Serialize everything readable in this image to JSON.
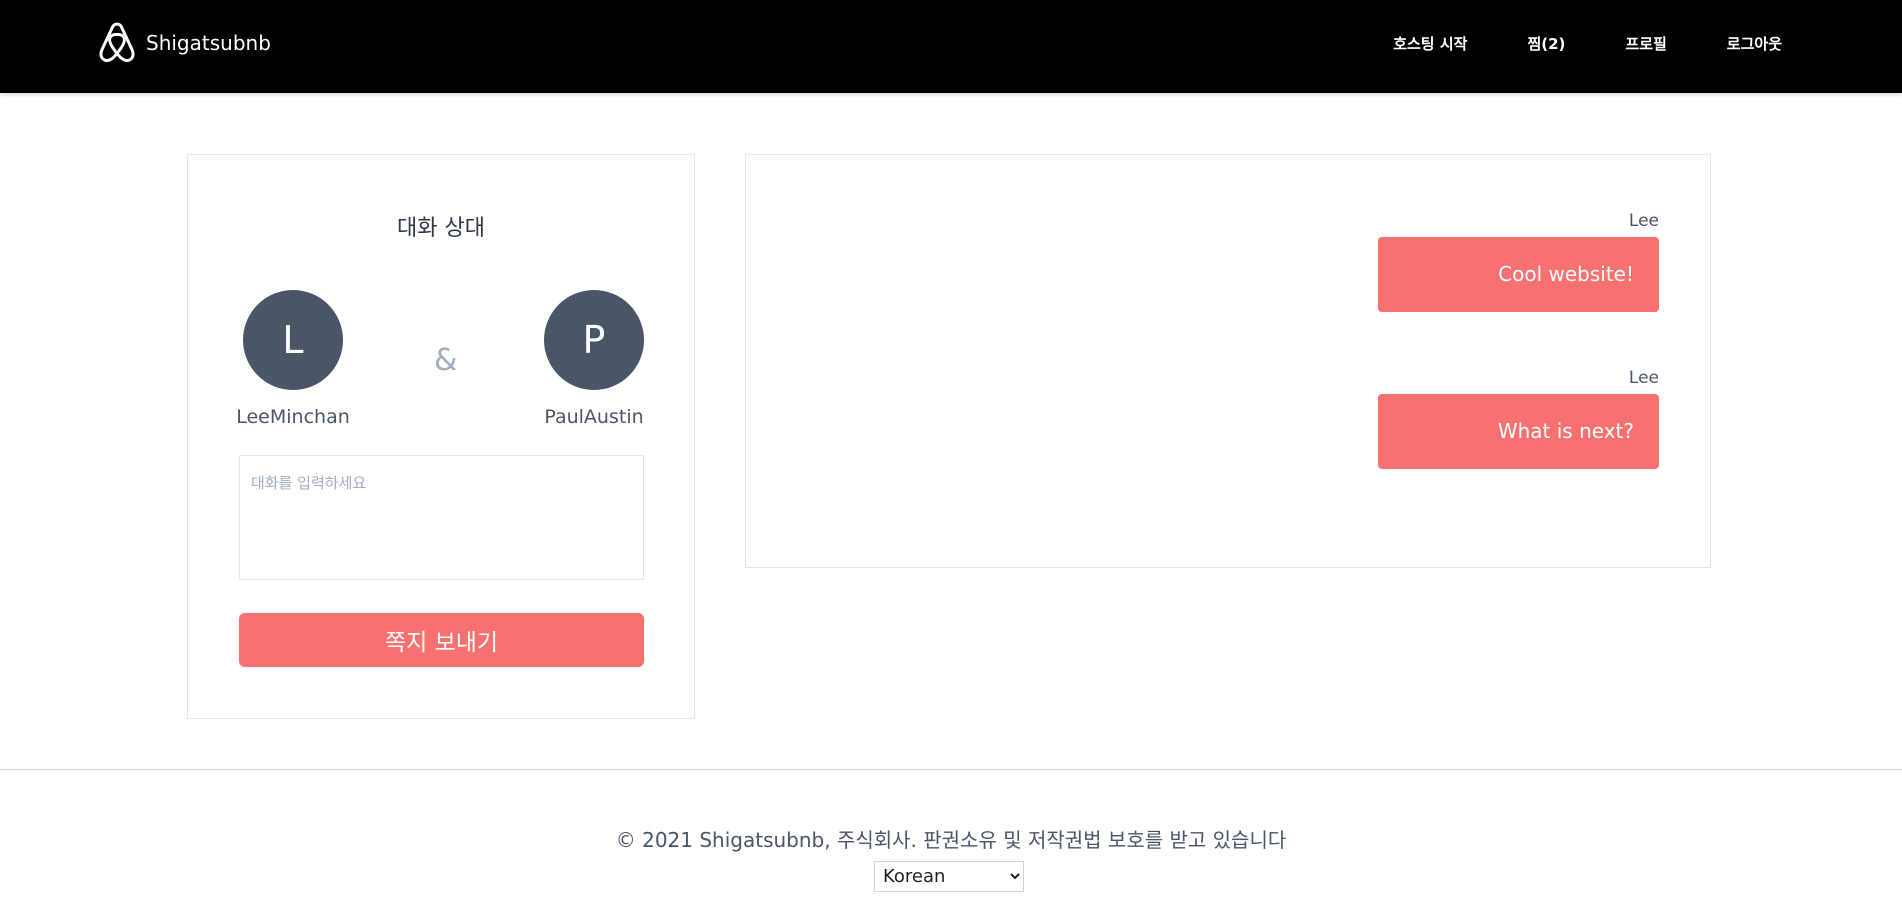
{
  "header": {
    "brand_name": "Shigatsubnb",
    "logo_icon": "airbnb-logo-icon",
    "nav": {
      "start_hosting": "호스팅 시작",
      "favorites": "찜(2)",
      "profile": "프로필",
      "logout": "로그아웃"
    }
  },
  "conversation": {
    "title": "대화 상대",
    "participants": [
      {
        "initial": "L",
        "name": "LeeMinchan"
      },
      {
        "initial": "P",
        "name": "PaulAustin"
      }
    ],
    "separator": "&",
    "input_placeholder": "대화를 입력하세요",
    "input_value": "",
    "send_label": "쪽지 보내기"
  },
  "messages": [
    {
      "author": "Lee",
      "text": "Cool website!"
    },
    {
      "author": "Lee",
      "text": "What is next?"
    }
  ],
  "footer": {
    "copyright": "© 2021 Shigatsubnb, 주식회사. 판권소유 및 저작권법 보호를 받고 있습니다",
    "language_selected": "Korean"
  },
  "colors": {
    "header_bg": "#000000",
    "accent": "#f87171",
    "avatar_bg": "#4a5568"
  }
}
